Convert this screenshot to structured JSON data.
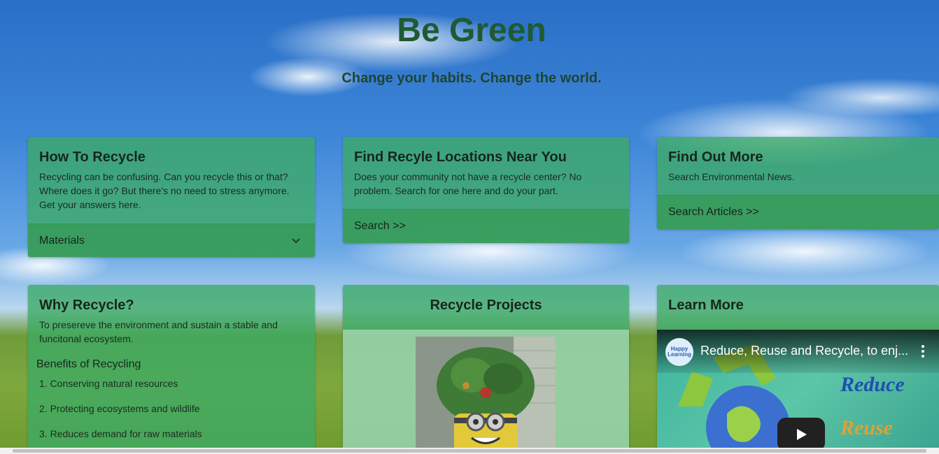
{
  "header": {
    "title": "Be Green",
    "subtitle": "Change your habits. Change the world."
  },
  "cards": {
    "how_to_recycle": {
      "title": "How To Recycle",
      "text": "Recycling can be confusing. Can you recycle this or that? Where does it go? But there's no need to stress anymore. Get your answers here.",
      "footer": "Materials"
    },
    "locations": {
      "title": "Find Recyle Locations Near You",
      "text": "Does your community not have a recycle center? No problem. Search for one here and do your part.",
      "footer": "Search >>"
    },
    "find_more": {
      "title": "Find Out More",
      "text": "Search Environmental News.",
      "footer": "Search Articles >>"
    },
    "why_recycle": {
      "title": "Why Recycle?",
      "text": "To presereve the environment and sustain a stable and funcitonal ecosystem.",
      "benefits_heading": "Benefits of Recycling",
      "benefits": [
        "1. Conserving natural resources",
        "2. Protecting ecosystems and wildlife",
        "3. Reduces demand for raw materials"
      ]
    },
    "projects": {
      "title": "Recycle Projects"
    },
    "learn_more": {
      "title": "Learn More",
      "video": {
        "title": "Reduce, Reuse and Recycle, to enj...",
        "channel_logo_text": "Happy Learning",
        "frame_text_1": "Reduce",
        "frame_text_2": "Reuse"
      }
    }
  },
  "colors": {
    "title": "#1f5a33",
    "card_bg": "rgba(60,170,100,0.78)"
  },
  "icons": {
    "materials_dropdown": "chevron-down-icon",
    "video_play": "play-icon",
    "video_menu": "kebab-menu-icon"
  }
}
